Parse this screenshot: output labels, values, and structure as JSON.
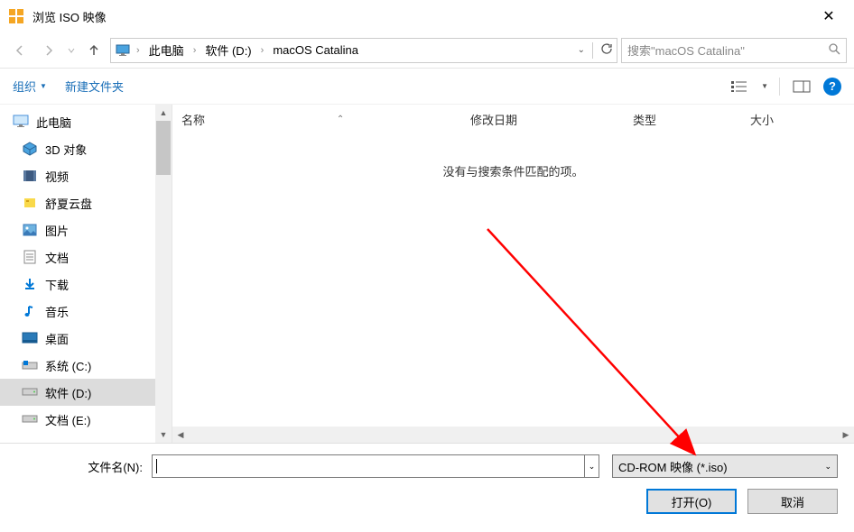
{
  "window": {
    "title": "浏览 ISO 映像",
    "close": "✕"
  },
  "nav": {
    "breadcrumbs": [
      "此电脑",
      "软件 (D:)",
      "macOS Catalina"
    ],
    "search_placeholder": "搜索\"macOS Catalina\""
  },
  "toolbar": {
    "organize": "组织",
    "new_folder": "新建文件夹"
  },
  "sidebar": {
    "items": [
      {
        "label": "此电脑",
        "icon": "monitor",
        "root": true
      },
      {
        "label": "3D 对象",
        "icon": "cube"
      },
      {
        "label": "视频",
        "icon": "film"
      },
      {
        "label": "舒夏云盘",
        "icon": "cloud"
      },
      {
        "label": "图片",
        "icon": "picture"
      },
      {
        "label": "文档",
        "icon": "doc"
      },
      {
        "label": "下载",
        "icon": "download"
      },
      {
        "label": "音乐",
        "icon": "music"
      },
      {
        "label": "桌面",
        "icon": "desktop"
      },
      {
        "label": "系统 (C:)",
        "icon": "drive-win"
      },
      {
        "label": "软件 (D:)",
        "icon": "drive",
        "selected": true
      },
      {
        "label": "文档 (E:)",
        "icon": "drive"
      }
    ]
  },
  "columns": {
    "name": "名称",
    "date": "修改日期",
    "type": "类型",
    "size": "大小"
  },
  "content": {
    "empty": "没有与搜索条件匹配的项。"
  },
  "footer": {
    "filename_label": "文件名(N):",
    "filetype": "CD-ROM 映像 (*.iso)",
    "open": "打开(O)",
    "cancel": "取消"
  }
}
